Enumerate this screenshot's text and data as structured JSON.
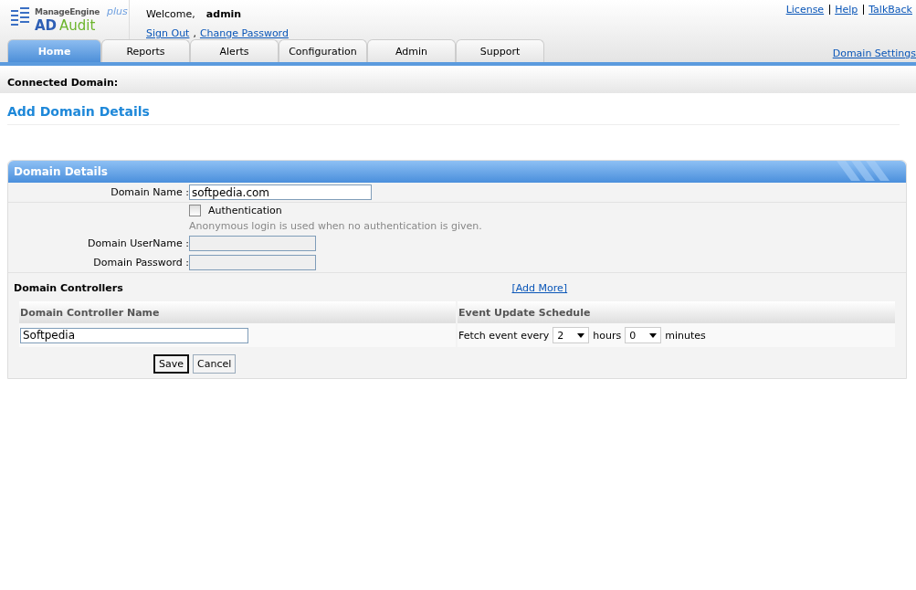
{
  "logo": {
    "brand": "ManageEngine",
    "edition": "plus",
    "prefix": "AD",
    "product": "Audit"
  },
  "user": {
    "greeting": "Welcome,",
    "name": "admin",
    "links": [
      "Sign Out",
      "Change Password"
    ],
    "separator": ","
  },
  "top_links": [
    "License",
    "Help",
    "TalkBack"
  ],
  "tabs": [
    {
      "label": "Home",
      "selected": true
    },
    {
      "label": "Reports",
      "selected": false
    },
    {
      "label": "Alerts",
      "selected": false
    },
    {
      "label": "Configuration",
      "selected": false
    },
    {
      "label": "Admin",
      "selected": false
    },
    {
      "label": "Support",
      "selected": false
    }
  ],
  "domain_settings": "Domain Settings",
  "connected_domain": "Connected Domain:",
  "page_title": "Add Domain Details",
  "panel": {
    "title": "Domain Details",
    "domain_name": {
      "label": "Domain Name :",
      "value": "softpedia.com"
    },
    "authentication": {
      "label": "Authentication",
      "checked": false,
      "hint": "Anonymous login is used when no authentication is given."
    },
    "username": {
      "label": "Domain UserName :",
      "disabled": true
    },
    "password": {
      "label": "Domain Password :",
      "disabled": true
    },
    "controllers": {
      "title": "Domain Controllers",
      "add_more": "[Add More]",
      "columns": [
        "Domain Controller Name",
        "Event Update Schedule"
      ],
      "rows": [
        {
          "name": "Softpedia",
          "prefix": "Fetch event every",
          "hours": "2",
          "hours_label": "hours",
          "minutes": "0",
          "minutes_label": "minutes"
        }
      ]
    },
    "buttons": [
      {
        "label": "Save",
        "default": true
      },
      {
        "label": "Cancel",
        "default": false
      }
    ]
  }
}
